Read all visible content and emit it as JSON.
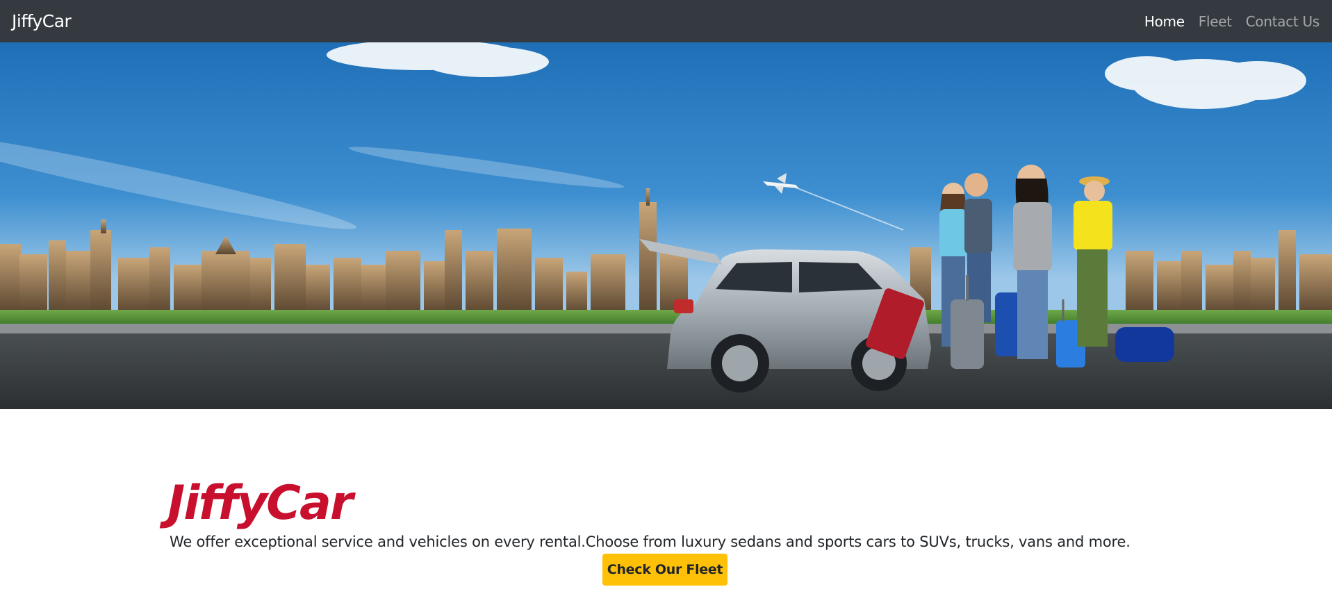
{
  "navbar": {
    "brand": "JiffyCar",
    "links": [
      {
        "label": "Home",
        "active": true
      },
      {
        "label": "Fleet",
        "active": false
      },
      {
        "label": "Contact Us",
        "active": false
      }
    ]
  },
  "hero": {
    "image": "car-rental-banner",
    "description_icons": [
      "city-skyline",
      "airplane",
      "silver-suv",
      "travelers-with-luggage"
    ]
  },
  "main": {
    "title": "JiffyCar",
    "description": "We offer exceptional service and vehicles on every rental.Choose from luxury sedans and sports cars to SUVs, trucks, vans and more.",
    "cta_label": "Check Our Fleet"
  },
  "colors": {
    "navbar_bg": "#343a40",
    "brand_red": "#c8102e",
    "cta_yellow": "#ffc107"
  }
}
